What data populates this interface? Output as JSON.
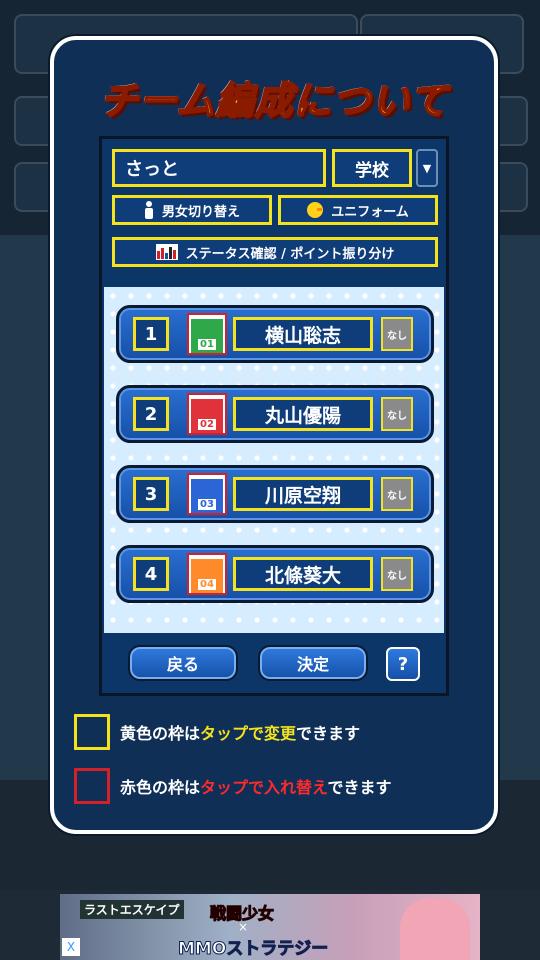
{
  "modal": {
    "title": "チーム編成について",
    "name_value": "さっと",
    "school_label": "学校",
    "gender_button": "男女切り替え",
    "uniform_button": "ユニフォーム",
    "status_button": "ステータス確認 / ポイント振り分け",
    "players": [
      {
        "number": "1",
        "jersey": "01",
        "name": "横山聡志",
        "slot": "なし",
        "jersey_color": "#2fa84a"
      },
      {
        "number": "2",
        "jersey": "02",
        "name": "丸山優陽",
        "slot": "なし",
        "jersey_color": "#e0323a"
      },
      {
        "number": "3",
        "jersey": "03",
        "name": "川原空翔",
        "slot": "なし",
        "jersey_color": "#2c66d6"
      },
      {
        "number": "4",
        "jersey": "04",
        "name": "北條葵大",
        "slot": "なし",
        "jersey_color": "#ff8a2a"
      }
    ],
    "back_button": "戻る",
    "ok_button": "決定",
    "help_button": "?",
    "legend_yellow": {
      "a": "黄色の枠は",
      "b": "タップで変更",
      "c": "できます"
    },
    "legend_red": {
      "a": "赤色の枠は",
      "b": "タップで入れ替え",
      "c": "できます"
    }
  },
  "ad": {
    "logo": "ラストエスケイプ",
    "line1": "戦闘少女",
    "line2": "×",
    "line3": "MMOストラテジー",
    "close": "X"
  },
  "colors": {
    "yellow_frame": "#f3e21d",
    "red_frame": "#d2212a",
    "panel_blue": "#0c3568"
  }
}
